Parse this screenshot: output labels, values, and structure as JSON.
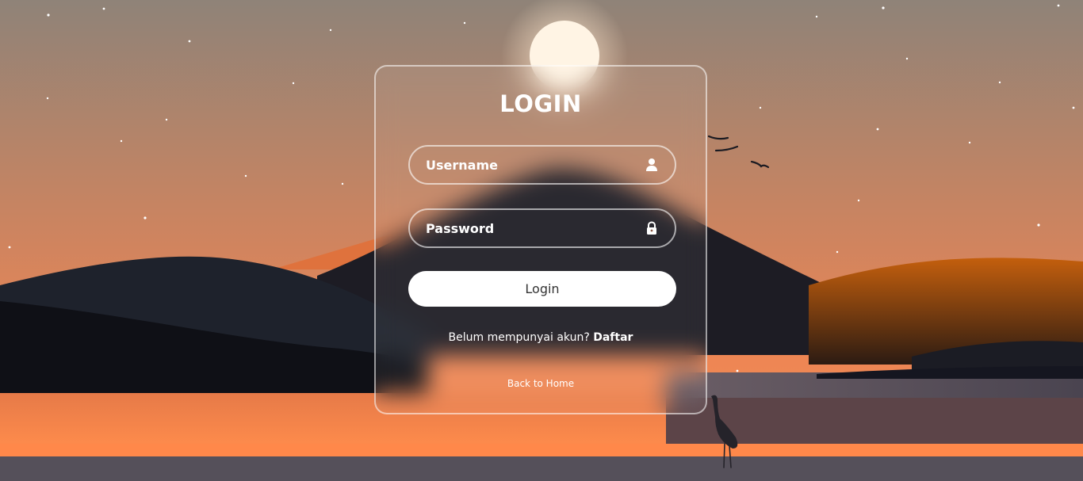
{
  "login": {
    "title": "LOGIN",
    "username_placeholder": "Username",
    "password_placeholder": "Password",
    "submit_label": "Login",
    "register_prompt": "Belum mempunyai akun?",
    "register_link": "Daftar",
    "back_link": "Back to Home",
    "username_icon": "user-icon",
    "password_icon": "lock-icon"
  },
  "colors": {
    "sky_top": "#8f8378",
    "sky_bottom": "#ee8654",
    "mountain_dark": "#1a1b23",
    "mountain_orange": "#d2681e",
    "water_orange": "#ff8a4a",
    "button_bg": "#ffffff"
  }
}
